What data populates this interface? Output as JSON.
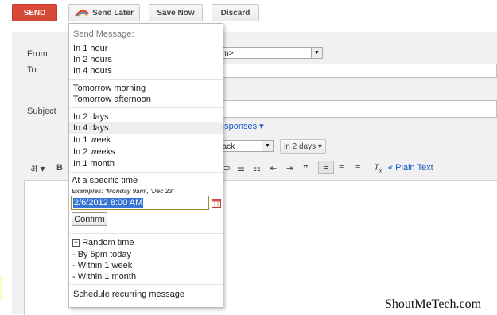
{
  "toolbar": {
    "send": "SEND",
    "send_later": "Send Later",
    "save_now": "Save Now",
    "discard": "Discard"
  },
  "compose": {
    "from_label": "From",
    "to_label": "To",
    "subject_label": "Subject",
    "from_value_fragment": "om>",
    "responses_link": "esponses",
    "followup_value": "back",
    "followup_delay": "in 2 days",
    "plain_text": "« Plain Text",
    "lang_glyph": "अ"
  },
  "menu": {
    "header": "Send Message:",
    "group1": [
      "In 1 hour",
      "In 2 hours",
      "In 4 hours"
    ],
    "group2": [
      "Tomorrow morning",
      "Tomorrow afternoon"
    ],
    "group3": [
      "In 2 days",
      "In 4 days",
      "In 1 week",
      "In 2 weeks",
      "In 1 month"
    ],
    "highlighted": "In 4 days",
    "specific_title": "At a specific time",
    "examples": "Examples: 'Monday 9am', 'Dec 23'",
    "datetime_value": "2/6/2012 8:00 AM",
    "confirm": "Confirm",
    "random_title": "Random time",
    "random_options": [
      "- By 5pm today",
      "- Within 1 week",
      "- Within 1 month"
    ],
    "recurring": "Schedule recurring message"
  },
  "watermark": "ShoutMeTech.com",
  "colors": {
    "send": "#d14836",
    "highlight": "#3875d7",
    "link": "#1155cc"
  }
}
